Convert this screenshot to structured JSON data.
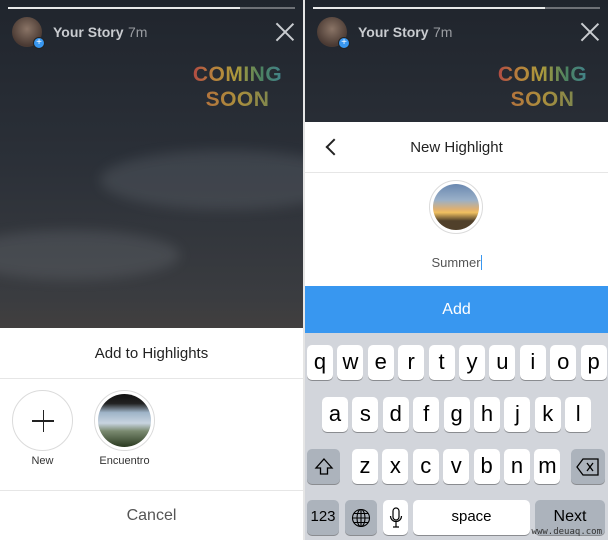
{
  "story": {
    "name": "Your Story",
    "time": "7m",
    "progress_percent": 81,
    "sticker_line1": "COMING",
    "sticker_line2": "SOON"
  },
  "left_sheet": {
    "title": "Add to Highlights",
    "items": [
      {
        "label": "New",
        "icon": "plus-icon"
      },
      {
        "label": "Encuentro",
        "icon": "highlight-cover"
      }
    ],
    "cancel": "Cancel"
  },
  "right_sheet": {
    "title": "New Highlight",
    "back_icon": "chevron-left-icon",
    "name_value": "Summer",
    "add_label": "Add"
  },
  "keyboard": {
    "row1": [
      "q",
      "w",
      "e",
      "r",
      "t",
      "y",
      "u",
      "i",
      "o",
      "p"
    ],
    "row2": [
      "a",
      "s",
      "d",
      "f",
      "g",
      "h",
      "j",
      "k",
      "l"
    ],
    "row3": [
      "z",
      "x",
      "c",
      "v",
      "b",
      "n",
      "m"
    ],
    "numbers": "123",
    "space": "space",
    "next": "Next"
  },
  "watermark": "www.deuaq.com",
  "colors": {
    "accent": "#3897f0",
    "keyboard_bg": "#d2d5db"
  }
}
